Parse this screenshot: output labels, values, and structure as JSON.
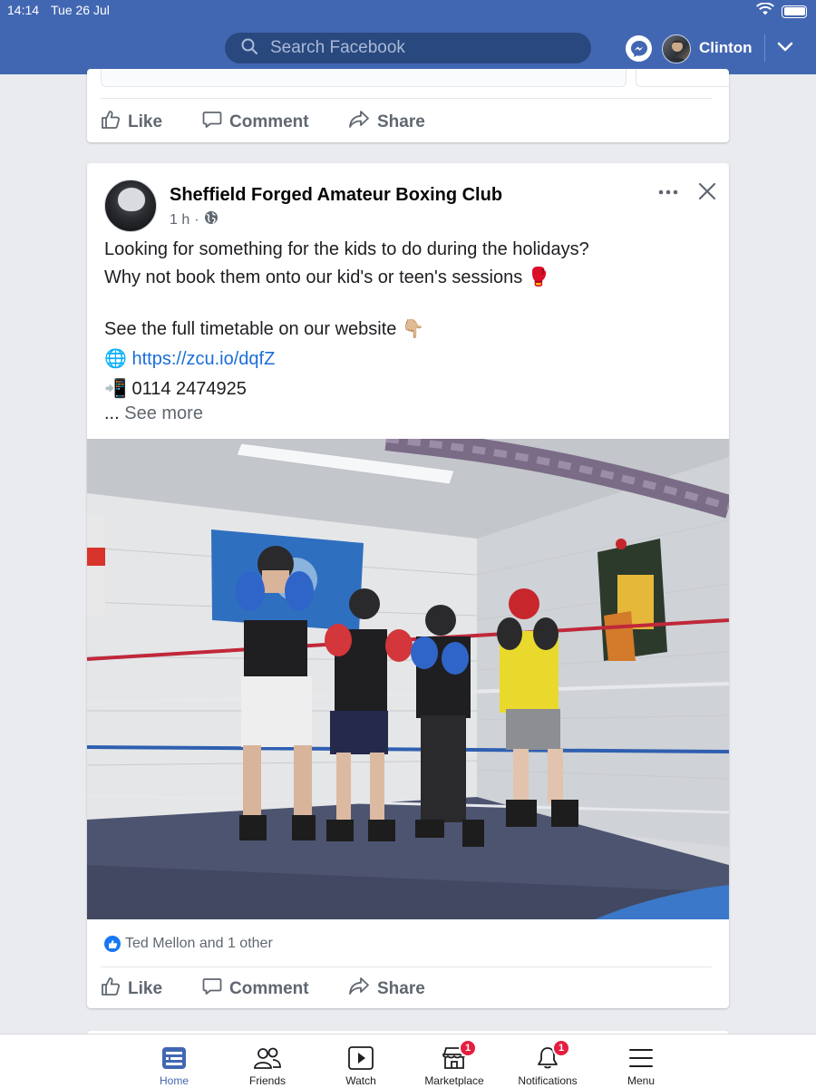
{
  "status_bar": {
    "time": "14:14",
    "date": "Tue 26 Jul"
  },
  "header": {
    "search_placeholder": "Search Facebook",
    "user_name": "Clinton",
    "icons": [
      "search-icon",
      "messenger-icon",
      "chevron-down-icon",
      "wifi-icon",
      "battery-icon"
    ],
    "accent_color": "#4267b2"
  },
  "previous_post": {
    "actions": {
      "like": "Like",
      "comment": "Comment",
      "share": "Share"
    }
  },
  "post": {
    "page_name": "Sheffield Forged Amateur Boxing Club",
    "time": "1 h",
    "separator": "·",
    "body_lines": [
      "Looking for something for the kids to do during the holidays?",
      "Why not book them onto our kid's or teen's sessions 🥊",
      "See the full timetable on our website 👇🏼"
    ],
    "link_prefix": "🌐",
    "link": "https://zcu.io/dqfZ",
    "phone_prefix": "📲",
    "phone": "0114 2474925",
    "see_more": "See more",
    "see_more_prefix": "...",
    "reactions_text": "Ted Mellon and 1 other",
    "actions": {
      "like": "Like",
      "comment": "Comment",
      "share": "Share"
    }
  },
  "tabbar": {
    "tabs": [
      {
        "label": "Home",
        "icon": "home-feed-icon",
        "active": true
      },
      {
        "label": "Friends",
        "icon": "friends-icon"
      },
      {
        "label": "Watch",
        "icon": "watch-play-icon"
      },
      {
        "label": "Marketplace",
        "icon": "marketplace-icon",
        "badge": "1"
      },
      {
        "label": "Notifications",
        "icon": "bell-icon",
        "badge": "1"
      },
      {
        "label": "Menu",
        "icon": "hamburger-menu-icon"
      }
    ]
  }
}
